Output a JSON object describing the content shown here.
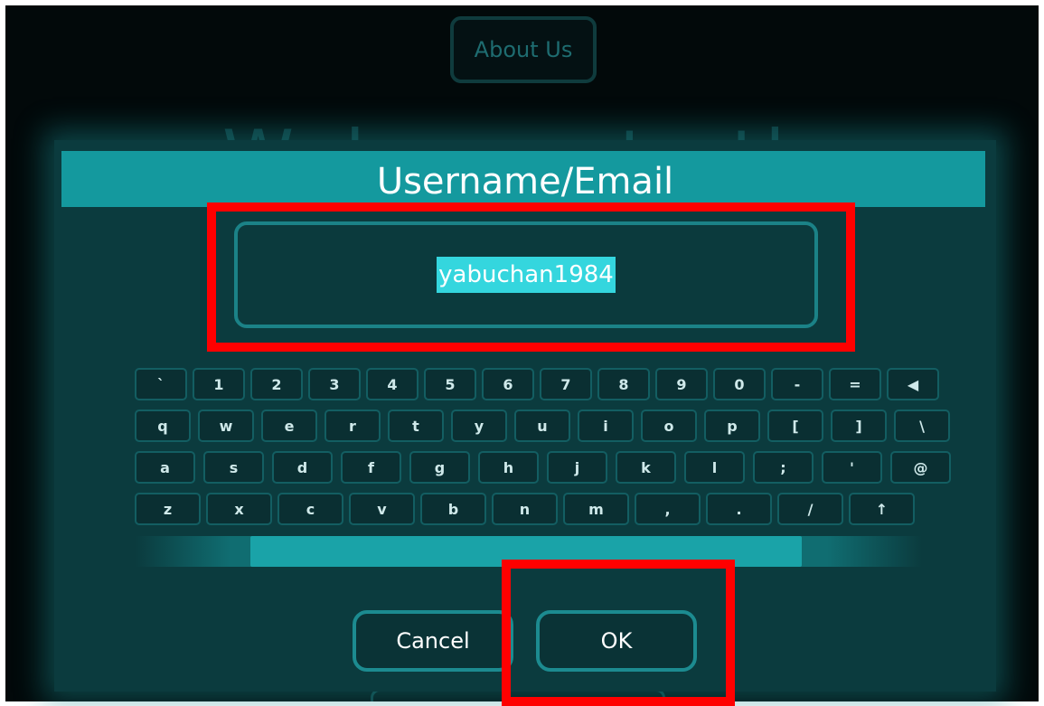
{
  "background": {
    "about_button_label": "About Us",
    "welcome_text": "Welcome to the world of"
  },
  "dialog": {
    "title": "Username/Email",
    "input_value": "yabuchan1984",
    "cancel_label": "Cancel",
    "ok_label": "OK"
  },
  "keyboard": {
    "row1": [
      "`",
      "1",
      "2",
      "3",
      "4",
      "5",
      "6",
      "7",
      "8",
      "9",
      "0",
      "-",
      "=",
      "◀"
    ],
    "row2": [
      "q",
      "w",
      "e",
      "r",
      "t",
      "y",
      "u",
      "i",
      "o",
      "p",
      "[",
      "]",
      "\\"
    ],
    "row3": [
      "a",
      "s",
      "d",
      "f",
      "g",
      "h",
      "j",
      "k",
      "l",
      ";",
      "'",
      "@"
    ],
    "row4": [
      "z",
      "x",
      "c",
      "v",
      "b",
      "n",
      "m",
      ",",
      ".",
      "/",
      "↑"
    ]
  },
  "colors": {
    "highlight": "#ff0000",
    "accent": "#14999e",
    "selection": "#34d6de"
  }
}
